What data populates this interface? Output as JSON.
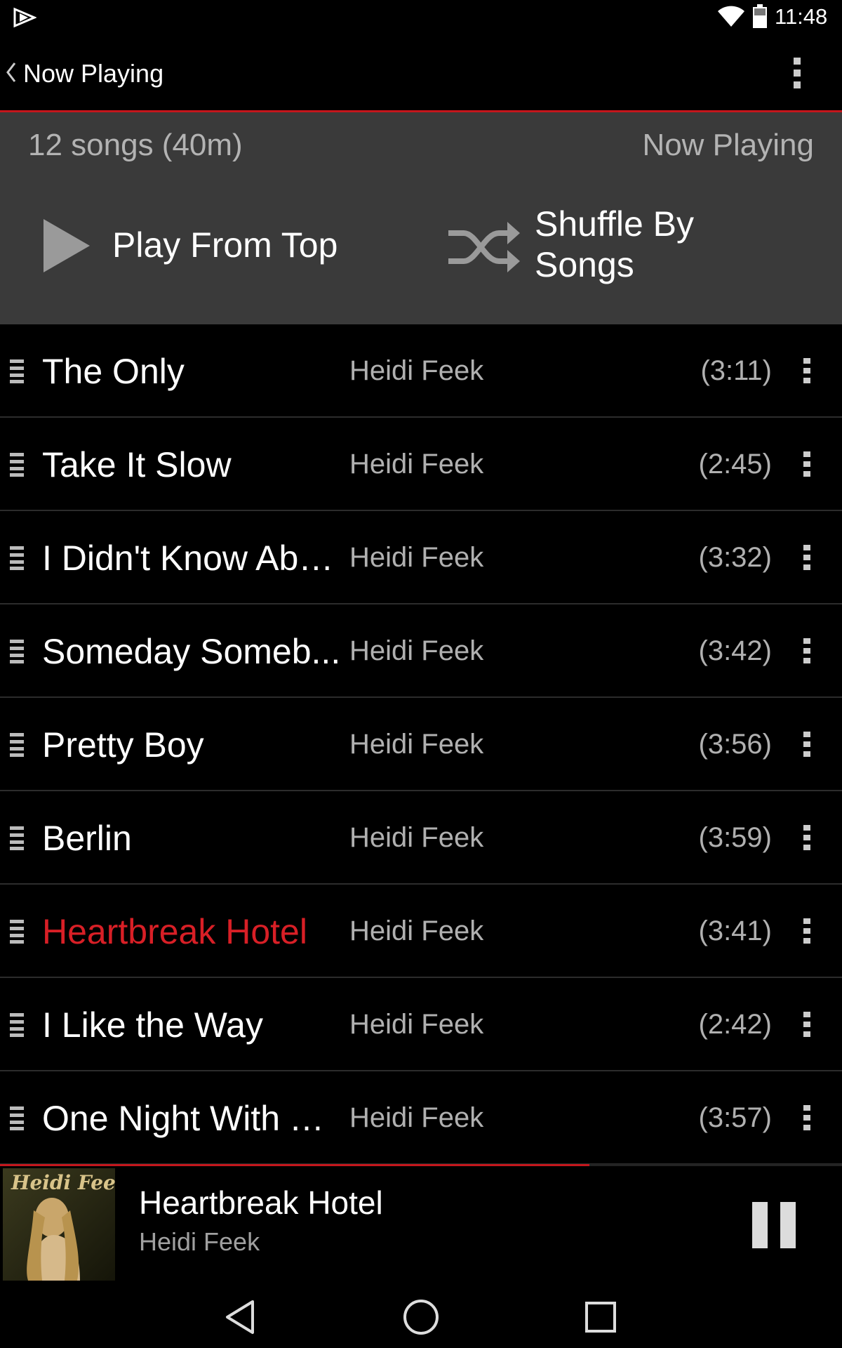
{
  "status_bar": {
    "time": "11:48",
    "icons": [
      "app-notification-icon",
      "wifi-icon",
      "battery-icon"
    ]
  },
  "action_bar": {
    "title": "Now Playing",
    "icons": [
      "back-chevron-icon",
      "overflow-menu-icon"
    ]
  },
  "header": {
    "song_count": "12 songs (40m)",
    "label": "Now Playing",
    "play_label": "Play From Top",
    "shuffle_label": "Shuffle By Songs"
  },
  "songs": [
    {
      "title": "The Only",
      "artist": "Heidi Feek",
      "duration": "(3:11)",
      "playing": false
    },
    {
      "title": "Take It Slow",
      "artist": "Heidi Feek",
      "duration": "(2:45)",
      "playing": false
    },
    {
      "title": "I Didn't Know Abo...",
      "artist": "Heidi Feek",
      "duration": "(3:32)",
      "playing": false
    },
    {
      "title": "Someday Someb...",
      "artist": "Heidi Feek",
      "duration": "(3:42)",
      "playing": false
    },
    {
      "title": "Pretty Boy",
      "artist": "Heidi Feek",
      "duration": "(3:56)",
      "playing": false
    },
    {
      "title": "Berlin",
      "artist": "Heidi Feek",
      "duration": "(3:59)",
      "playing": false
    },
    {
      "title": "Heartbreak Hotel",
      "artist": "Heidi Feek",
      "duration": "(3:41)",
      "playing": true
    },
    {
      "title": "I Like the Way",
      "artist": "Heidi Feek",
      "duration": "(2:42)",
      "playing": false
    },
    {
      "title": "One Night With You",
      "artist": "Heidi Feek",
      "duration": "(3:57)",
      "playing": false
    }
  ],
  "mini_player": {
    "title": "Heartbreak Hotel",
    "artist": "Heidi Feek",
    "progress": 0.7,
    "album_art_text": "Heidi Feek",
    "icons": [
      "album-art-image",
      "pause-icon"
    ]
  },
  "nav_bar": {
    "icons": [
      "back-icon",
      "home-icon",
      "recents-icon"
    ]
  },
  "colors": {
    "accent": "#c4161c",
    "playing_text": "#d81f26",
    "header_bg": "#3a3a3a",
    "secondary_text": "#b0b0b0"
  }
}
